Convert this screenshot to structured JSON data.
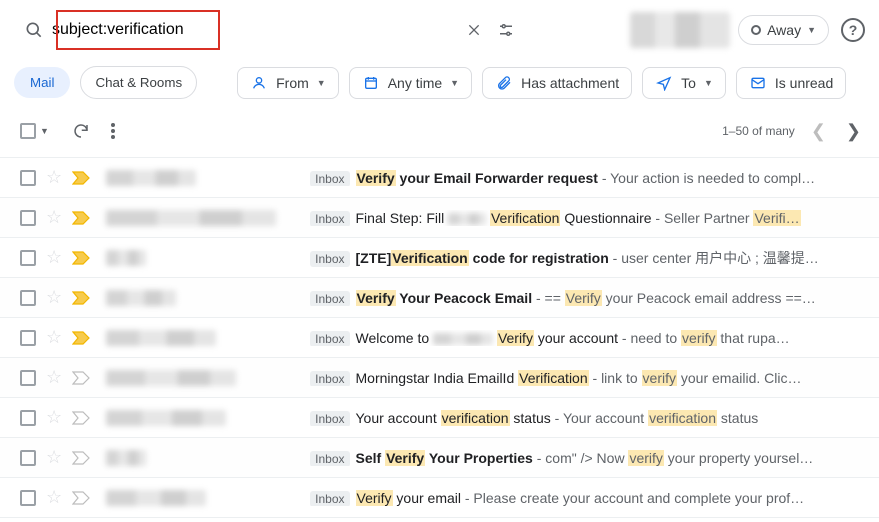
{
  "search": {
    "value": "subject:verification"
  },
  "status": {
    "label": "Away"
  },
  "tabs": {
    "mail": "Mail",
    "chat": "Chat & Rooms"
  },
  "chips": {
    "from": "From",
    "anytime": "Any time",
    "has_attachment": "Has attachment",
    "to": "To",
    "is_unread": "Is unread"
  },
  "pager": {
    "label": "1–50 of many"
  },
  "labels": {
    "inbox": "Inbox"
  },
  "rows": [
    {
      "imp": "yellow",
      "sender_w": 90,
      "subject_html": "<b><mark>Verify</mark> your Email Forwarder request</b> <span class='snip'>- Your action is needed to compl…</span>"
    },
    {
      "imp": "yellow",
      "sender_w": 170,
      "subject_html": "Final Step: Fill <span class='blur-sender' style='display:inline-block;width:38px;height:12px;vertical-align:middle'></span> <mark>Verification</mark> Questionnaire <span class='snip'>- Seller Partner <mark>Verifi…</mark></span>"
    },
    {
      "imp": "yellow",
      "sender_w": 40,
      "subject_html": "<b>[ZTE]<mark>Verification</mark> code for registration</b> <span class='snip'>- user center 用户中心 ; 温馨提…</span>"
    },
    {
      "imp": "yellow",
      "sender_w": 70,
      "subject_html": "<b><mark>Verify</mark> Your Peacock Email</b> <span class='snip'>- == <mark>Verify</mark> your Peacock email address ==…</span>"
    },
    {
      "imp": "yellow",
      "sender_w": 110,
      "subject_html": "Welcome to <span class='blur-sender' style='display:inline-block;width:60px;height:12px;vertical-align:middle'></span> <mark>Verify</mark> your account <span class='snip'>- need to <mark>verify</mark> that rupa…</span>"
    },
    {
      "imp": "gray",
      "sender_w": 130,
      "subject_html": "Morningstar India EmailId <mark>Verification</mark> <span class='snip'>- link to <mark>verify</mark> your emailid. Clic…</span>"
    },
    {
      "imp": "gray",
      "sender_w": 120,
      "subject_html": "Your account <mark>verification</mark> status <span class='snip'>- Your account <mark>verification</mark> status</span>"
    },
    {
      "imp": "gray",
      "sender_w": 40,
      "subject_html": "<b>Self <mark>Verify</mark> Your Properties</b> <span class='snip'>- com\" /> Now <mark>verify</mark> your property yoursel…</span>"
    },
    {
      "imp": "gray",
      "sender_w": 100,
      "subject_html": "<mark>Verify</mark> your email <span class='snip'>- Please create your account and complete your prof…</span>"
    }
  ]
}
